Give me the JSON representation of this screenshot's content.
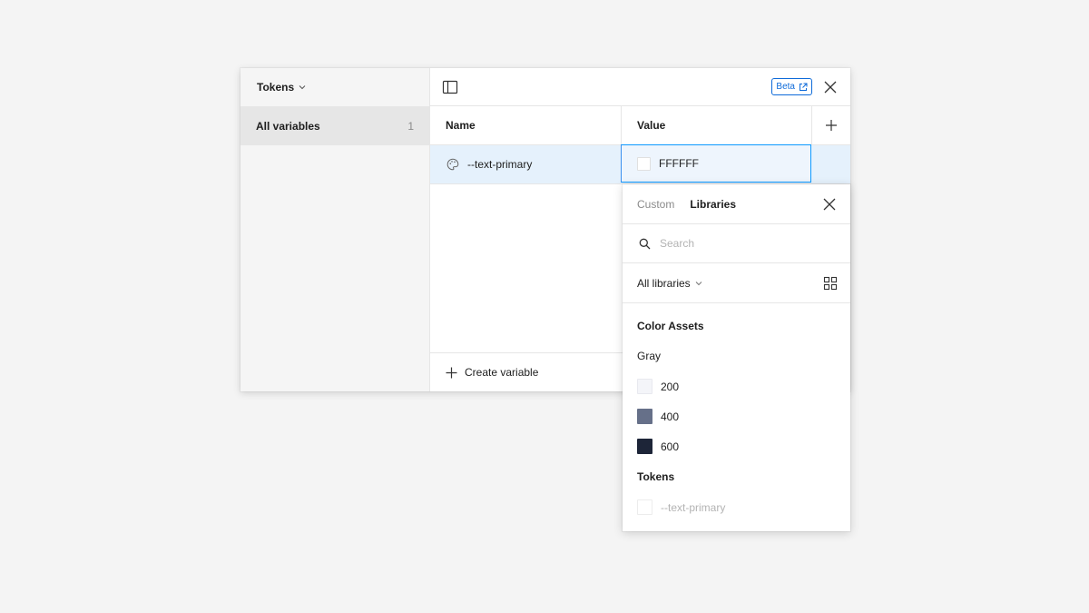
{
  "sidebar": {
    "collection_title": "Tokens",
    "items": [
      {
        "label": "All variables",
        "count": "1"
      }
    ]
  },
  "toolbar": {
    "beta_label": "Beta"
  },
  "table": {
    "headers": {
      "name": "Name",
      "value": "Value"
    },
    "rows": [
      {
        "name": "--text-primary",
        "value": "FFFFFF",
        "swatch": "#ffffff"
      }
    ]
  },
  "footer": {
    "create_label": "Create variable"
  },
  "popover": {
    "tabs": [
      "Custom",
      "Libraries"
    ],
    "active_tab": "Libraries",
    "search_placeholder": "Search",
    "library_select": "All libraries",
    "section_title": "Color Assets",
    "groups": [
      {
        "title": "Gray",
        "items": [
          {
            "label": "200",
            "color": "#f4f5f9"
          },
          {
            "label": "400",
            "color": "#667089"
          },
          {
            "label": "600",
            "color": "#1d2538"
          }
        ]
      },
      {
        "title": "Tokens",
        "items": [
          {
            "label": "--text-primary",
            "color": "#ffffff"
          }
        ]
      }
    ]
  },
  "colors": {
    "accent": "#0d99ff",
    "beta": "#0d6ad9",
    "selected_row": "#e5f1fc"
  }
}
